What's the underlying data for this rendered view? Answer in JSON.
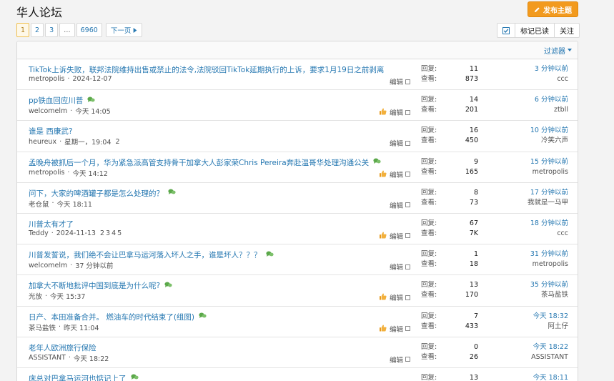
{
  "forum_title": "华人论坛",
  "post_button_label": "发布主题",
  "pagination": {
    "pages": [
      "1",
      "2",
      "3",
      "…",
      "6960"
    ],
    "current": "1",
    "next_label": "下一页"
  },
  "tools": {
    "mark_read": "标记已读",
    "follow": "关注"
  },
  "filter_label": "过滤器",
  "labels": {
    "replies": "回复:",
    "views": "查看:",
    "edit": "编辑"
  },
  "threads": [
    {
      "title": "TikTok上诉失败，联邦法院维持出售或禁止的法令,法院驳回TikTok延期执行的上诉，要求1月19日之前剥离",
      "author": "metropolis",
      "date": "2024-12-07",
      "replies": "11",
      "views": "873",
      "last_time": "3 分钟以前",
      "last_user": "ccc",
      "chat": false,
      "liked": false,
      "pages": []
    },
    {
      "title": "pp铁血回应川普",
      "author": "welcomelm",
      "date": "今天 14:05",
      "replies": "14",
      "views": "201",
      "last_time": "6 分钟以前",
      "last_user": "ztbll",
      "chat": true,
      "liked": true,
      "pages": []
    },
    {
      "title": "谁是 西康武?",
      "author": "heureux",
      "date": "星期一，19:04",
      "replies": "16",
      "views": "450",
      "last_time": "10 分钟以前",
      "last_user": "冷笑六声",
      "chat": false,
      "liked": false,
      "pages": [
        "2"
      ]
    },
    {
      "title": "孟晚舟被抓后一个月，华为紧急派高管支持骨干加拿大人彭家荣Chris Pereira奔赴温哥华处理沟通公关",
      "author": "metropolis",
      "date": "今天 14:12",
      "replies": "9",
      "views": "165",
      "last_time": "15 分钟以前",
      "last_user": "metropolis",
      "chat": true,
      "liked": true,
      "pages": []
    },
    {
      "title": "问下，大家的啤酒罐子都是怎么处理的？",
      "author": "老仓鼠",
      "date": "今天 18:11",
      "replies": "8",
      "views": "73",
      "last_time": "17 分钟以前",
      "last_user": "我就是一马甲",
      "chat": true,
      "liked": false,
      "pages": []
    },
    {
      "title": "川普太有才了",
      "author": "Teddy",
      "date": "2024-11-13",
      "replies": "67",
      "views": "7K",
      "last_time": "18 分钟以前",
      "last_user": "ccc",
      "chat": false,
      "liked": true,
      "pages": [
        "2",
        "3",
        "4",
        "5"
      ]
    },
    {
      "title": "川普发誓说，我们绝不会让巴拿马运河落入坏人之手，谁是坏人？？？",
      "author": "welcomelm",
      "date": "37 分钟以前",
      "replies": "1",
      "views": "18",
      "last_time": "31 分钟以前",
      "last_user": "metropolis",
      "chat": true,
      "liked": false,
      "pages": []
    },
    {
      "title": "加拿大不断地批评中国到底是为什么呢?",
      "author": "光放",
      "date": "今天 15:37",
      "replies": "13",
      "views": "170",
      "last_time": "35 分钟以前",
      "last_user": "茶马盐铁",
      "chat": true,
      "liked": true,
      "pages": []
    },
    {
      "title": "日产、本田准备合并。 燃油车的时代结束了(组图)",
      "author": "茶马盐铁",
      "date": "昨天 11:04",
      "replies": "7",
      "views": "433",
      "last_time": "今天 18:32",
      "last_user": "阿土仔",
      "chat": true,
      "liked": true,
      "pages": []
    },
    {
      "title": "老年人欧洲旅行保险",
      "author": "ASSISTANT",
      "date": "今天 18:22",
      "replies": "0",
      "views": "26",
      "last_time": "今天 18:22",
      "last_user": "ASSISTANT",
      "chat": false,
      "liked": false,
      "pages": []
    },
    {
      "title": "床总对巴拿马运河也惦记上了",
      "author": "",
      "date": "",
      "replies": "13",
      "views": "",
      "last_time": "今天 18:11",
      "last_user": "",
      "chat": true,
      "liked": false,
      "pages": []
    }
  ]
}
